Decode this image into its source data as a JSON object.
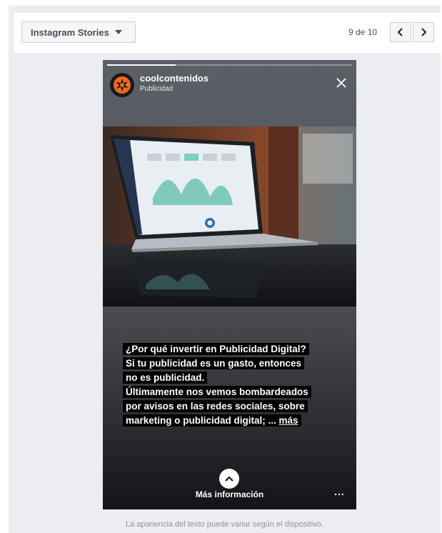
{
  "toolbar": {
    "placement_label": "Instagram Stories",
    "counter": "9 de 10"
  },
  "story": {
    "progress": 0.28,
    "account_name": "coolcontenidos",
    "sponsored_label": "Publicidad",
    "caption_lines": [
      "¿Por qué invertir en Publicidad Digital?",
      "Si tu publicidad es un gasto, entonces",
      "no es publicidad.",
      "Últimamente nos vemos bombardeados",
      "por avisos en las redes sociales, sobre",
      "marketing o publicidad digital; ..."
    ],
    "more_label": "más",
    "cta_label": "Más información",
    "options_label": "..."
  },
  "footnote": "La apariencia del texto puede variar según el dispositivo.",
  "colors": {
    "brand_orange": "#f26a1b",
    "panel_bg": "#ebedf0"
  },
  "icons": [
    "caret-down-icon",
    "chevron-left-icon",
    "chevron-right-icon",
    "close-icon",
    "chevron-up-icon",
    "brand-logo-icon"
  ]
}
